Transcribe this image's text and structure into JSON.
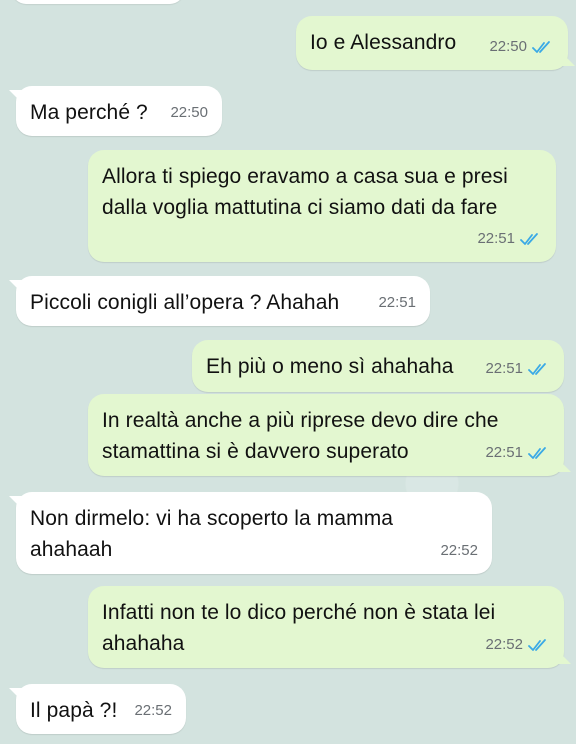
{
  "messages": [
    {
      "text": "Io e Alessandro",
      "time": "22:50"
    },
    {
      "text": "Ma perché ?",
      "time": "22:50"
    },
    {
      "text": "Allora ti spiego eravamo a casa sua e presi\ndalla voglia mattutina ci siamo dati da fare",
      "time": "22:51"
    },
    {
      "text": "Piccoli conigli all’opera ? Ahahah",
      "time": "22:51"
    },
    {
      "text": "Eh più o meno sì ahahaha",
      "time": "22:51"
    },
    {
      "text": "In realtà anche a più riprese devo dire che\nstamattina si è davvero superato",
      "time": "22:51"
    },
    {
      "text": "Non dirmelo: vi ha scoperto la mamma\nahahaah",
      "time": "22:52"
    },
    {
      "text": "Infatti non te lo dico perché non è stata lei\nahahaha",
      "time": "22:52"
    },
    {
      "text": "Il papà ?!",
      "time": "22:52"
    }
  ],
  "icons": {
    "read_receipt": "double-check-icon"
  },
  "colors": {
    "outgoing_bubble": "#e3f7d0",
    "incoming_bubble": "#ffffff",
    "chat_background": "#d3e3df",
    "read_ticks": "#3aa9e6"
  }
}
